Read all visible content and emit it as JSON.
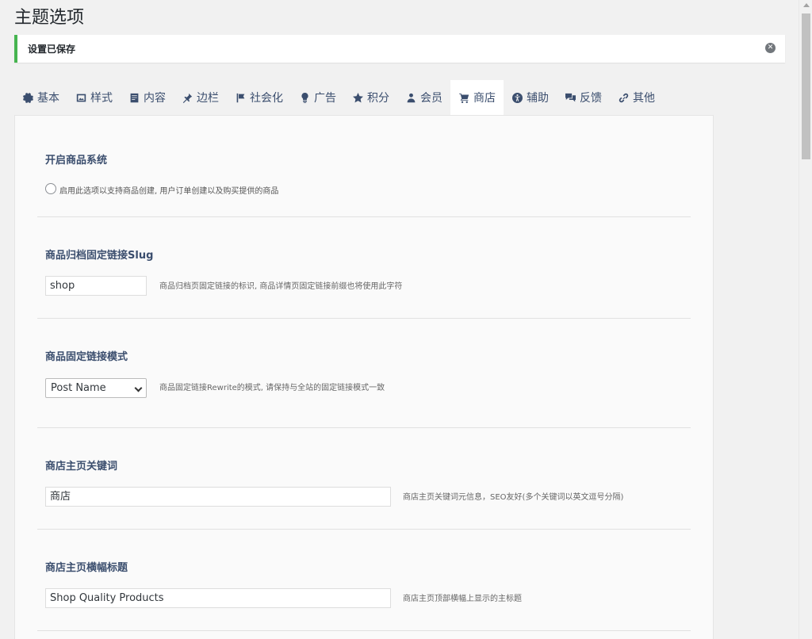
{
  "page": {
    "title": "主题选项"
  },
  "notice": {
    "text": "设置已保存"
  },
  "tabs": [
    {
      "label": "基本",
      "icon": "gear-icon"
    },
    {
      "label": "样式",
      "icon": "image-icon"
    },
    {
      "label": "内容",
      "icon": "document-icon"
    },
    {
      "label": "边栏",
      "icon": "pin-icon"
    },
    {
      "label": "社会化",
      "icon": "flag-icon"
    },
    {
      "label": "广告",
      "icon": "lightbulb-icon"
    },
    {
      "label": "积分",
      "icon": "star-icon"
    },
    {
      "label": "会员",
      "icon": "users-icon"
    },
    {
      "label": "商店",
      "icon": "cart-icon",
      "active": true
    },
    {
      "label": "辅助",
      "icon": "accessibility-icon"
    },
    {
      "label": "反馈",
      "icon": "comments-icon"
    },
    {
      "label": "其他",
      "icon": "link-icon"
    }
  ],
  "sections": {
    "enable_shop": {
      "title": "开启商品系统",
      "radio_label": "启用此选项以支持商品创建, 用户订单创建以及购买提供的商品"
    },
    "archive_slug": {
      "title": "商品归档固定链接Slug",
      "value": "shop",
      "desc": "商品归档页固定链接的标识, 商品详情页固定链接前缀也将使用此字符"
    },
    "permalink_mode": {
      "title": "商品固定链接模式",
      "selected": "Post Name",
      "desc": "商品固定链接Rewrite的模式, 请保持与全站的固定链接模式一致"
    },
    "home_keywords": {
      "title": "商店主页关键词",
      "value": "商店",
      "desc": "商店主页关键词元信息，SEO友好(多个关键词以英文逗号分隔)"
    },
    "banner_title": {
      "title": "商店主页横幅标题",
      "value": "Shop Quality Products",
      "desc": "商店主页顶部横幅上显示的主标题"
    }
  },
  "colors": {
    "accent_success": "#46b450",
    "tab_text": "#3b4e6e",
    "panel_bg": "#fafafa"
  }
}
